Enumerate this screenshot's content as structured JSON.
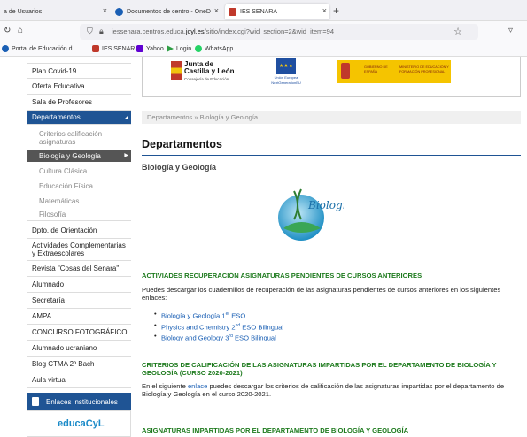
{
  "browser": {
    "tabs": [
      {
        "label": "a de Usuarios",
        "active": false,
        "close": "×"
      },
      {
        "label": "Documentos de centro - OneD",
        "active": false,
        "close": "×"
      },
      {
        "label": "IES SENARA",
        "active": true,
        "close": "×"
      }
    ],
    "new_tab": "+",
    "url_prefix": "iessenara.centros.educa.",
    "url_domain": "jcyl.es",
    "url_suffix": "/sitio/index.cgi?wid_section=2&wid_item=94",
    "bookmarks": [
      {
        "label": "Portal de Educación d...",
        "color": "#1a5fb4"
      },
      {
        "label": "IES SENARA",
        "color": "#c0392b"
      },
      {
        "label": "Yahoo",
        "color": "#6001d2"
      },
      {
        "label": "Login",
        "color": "#2e9e44"
      },
      {
        "label": "WhatsApp",
        "color": "#25d366"
      }
    ]
  },
  "sidebar": {
    "items": [
      {
        "label": "Plan Covid-19"
      },
      {
        "label": "Oferta Educativa"
      },
      {
        "label": "Sala de Profesores"
      },
      {
        "label": "Departamentos"
      },
      {
        "label": "Criterios calificación asignaturas"
      },
      {
        "label": "Biología y Geología"
      },
      {
        "label": "Cultura Clásica"
      },
      {
        "label": "Educación Física"
      },
      {
        "label": "Matemáticas"
      },
      {
        "label": "Filosofía"
      },
      {
        "label": "Dpto. de Orientación"
      },
      {
        "label": "Actividades Complementarias y Extraescolares"
      },
      {
        "label": "Revista \"Cosas del Senara\""
      },
      {
        "label": "Alumnado"
      },
      {
        "label": "Secretaría"
      },
      {
        "label": "AMPA"
      },
      {
        "label": "CONCURSO FOTOGRÁFICO"
      },
      {
        "label": "Alumnado ucraniano"
      },
      {
        "label": "Blog CTMA 2º Bach"
      },
      {
        "label": "Aula virtual"
      }
    ],
    "links_header": "Enlaces institucionales",
    "educa_logo": "educaCyL"
  },
  "logos": {
    "jcyl_line1": "Junta de",
    "jcyl_line2": "Castilla y León",
    "jcyl_line3": "Consejería de Educación",
    "eu_line1": "Unión Europea",
    "eu_line2": "NextGenerationEU",
    "gob_a": "GOBIERNO DE ESPAÑA",
    "gob_b": "MINISTERIO DE EDUCACIÓN Y FORMACIÓN PROFESIONAL"
  },
  "main": {
    "breadcrumb": "Departamentos » Biología y Geología",
    "title": "Departamentos",
    "subtitle": "Biología y Geología",
    "logo_text": "Biología",
    "section1": {
      "heading": "ACTIVIADES RECUPERACIÓN ASIGNATURAS PENDIENTES DE CURSOS ANTERIORES",
      "text": "Puedes descargar los cuadernillos de recuperación de las asignaturas pendientes de cursos anteriores en los siguientes enlaces:",
      "links": [
        {
          "pre": "Biología y Geología 1",
          "sup": "er",
          "post": " ESO"
        },
        {
          "pre": "Physics and Chemistry 2",
          "sup": "nd",
          "post": " ESO Bilingual"
        },
        {
          "pre": "Biology and Geology 3",
          "sup": "rd",
          "post": " ESO Bilingual"
        }
      ]
    },
    "section2": {
      "heading": "CRITERIOS DE CALIFICACIÓN DE LAS ASIGNATURAS IMPARTIDAS POR EL DEPARTAMENTO DE BIOLOGÍA Y GEOLOGÍA (CURSO 2020-2021)",
      "text_pre": "En el siguiente ",
      "link": "enlace",
      "text_post": " puedes descargar los criterios de calificación de las asignaturas impartidas por el departamento de Biología y Geología en el curso 2020-2021."
    },
    "section3": {
      "heading": "ASIGNATURAS IMPARTIDAS POR EL DEPARTAMENTO DE BIOLOGÍA Y GEOLOGÍA"
    }
  }
}
